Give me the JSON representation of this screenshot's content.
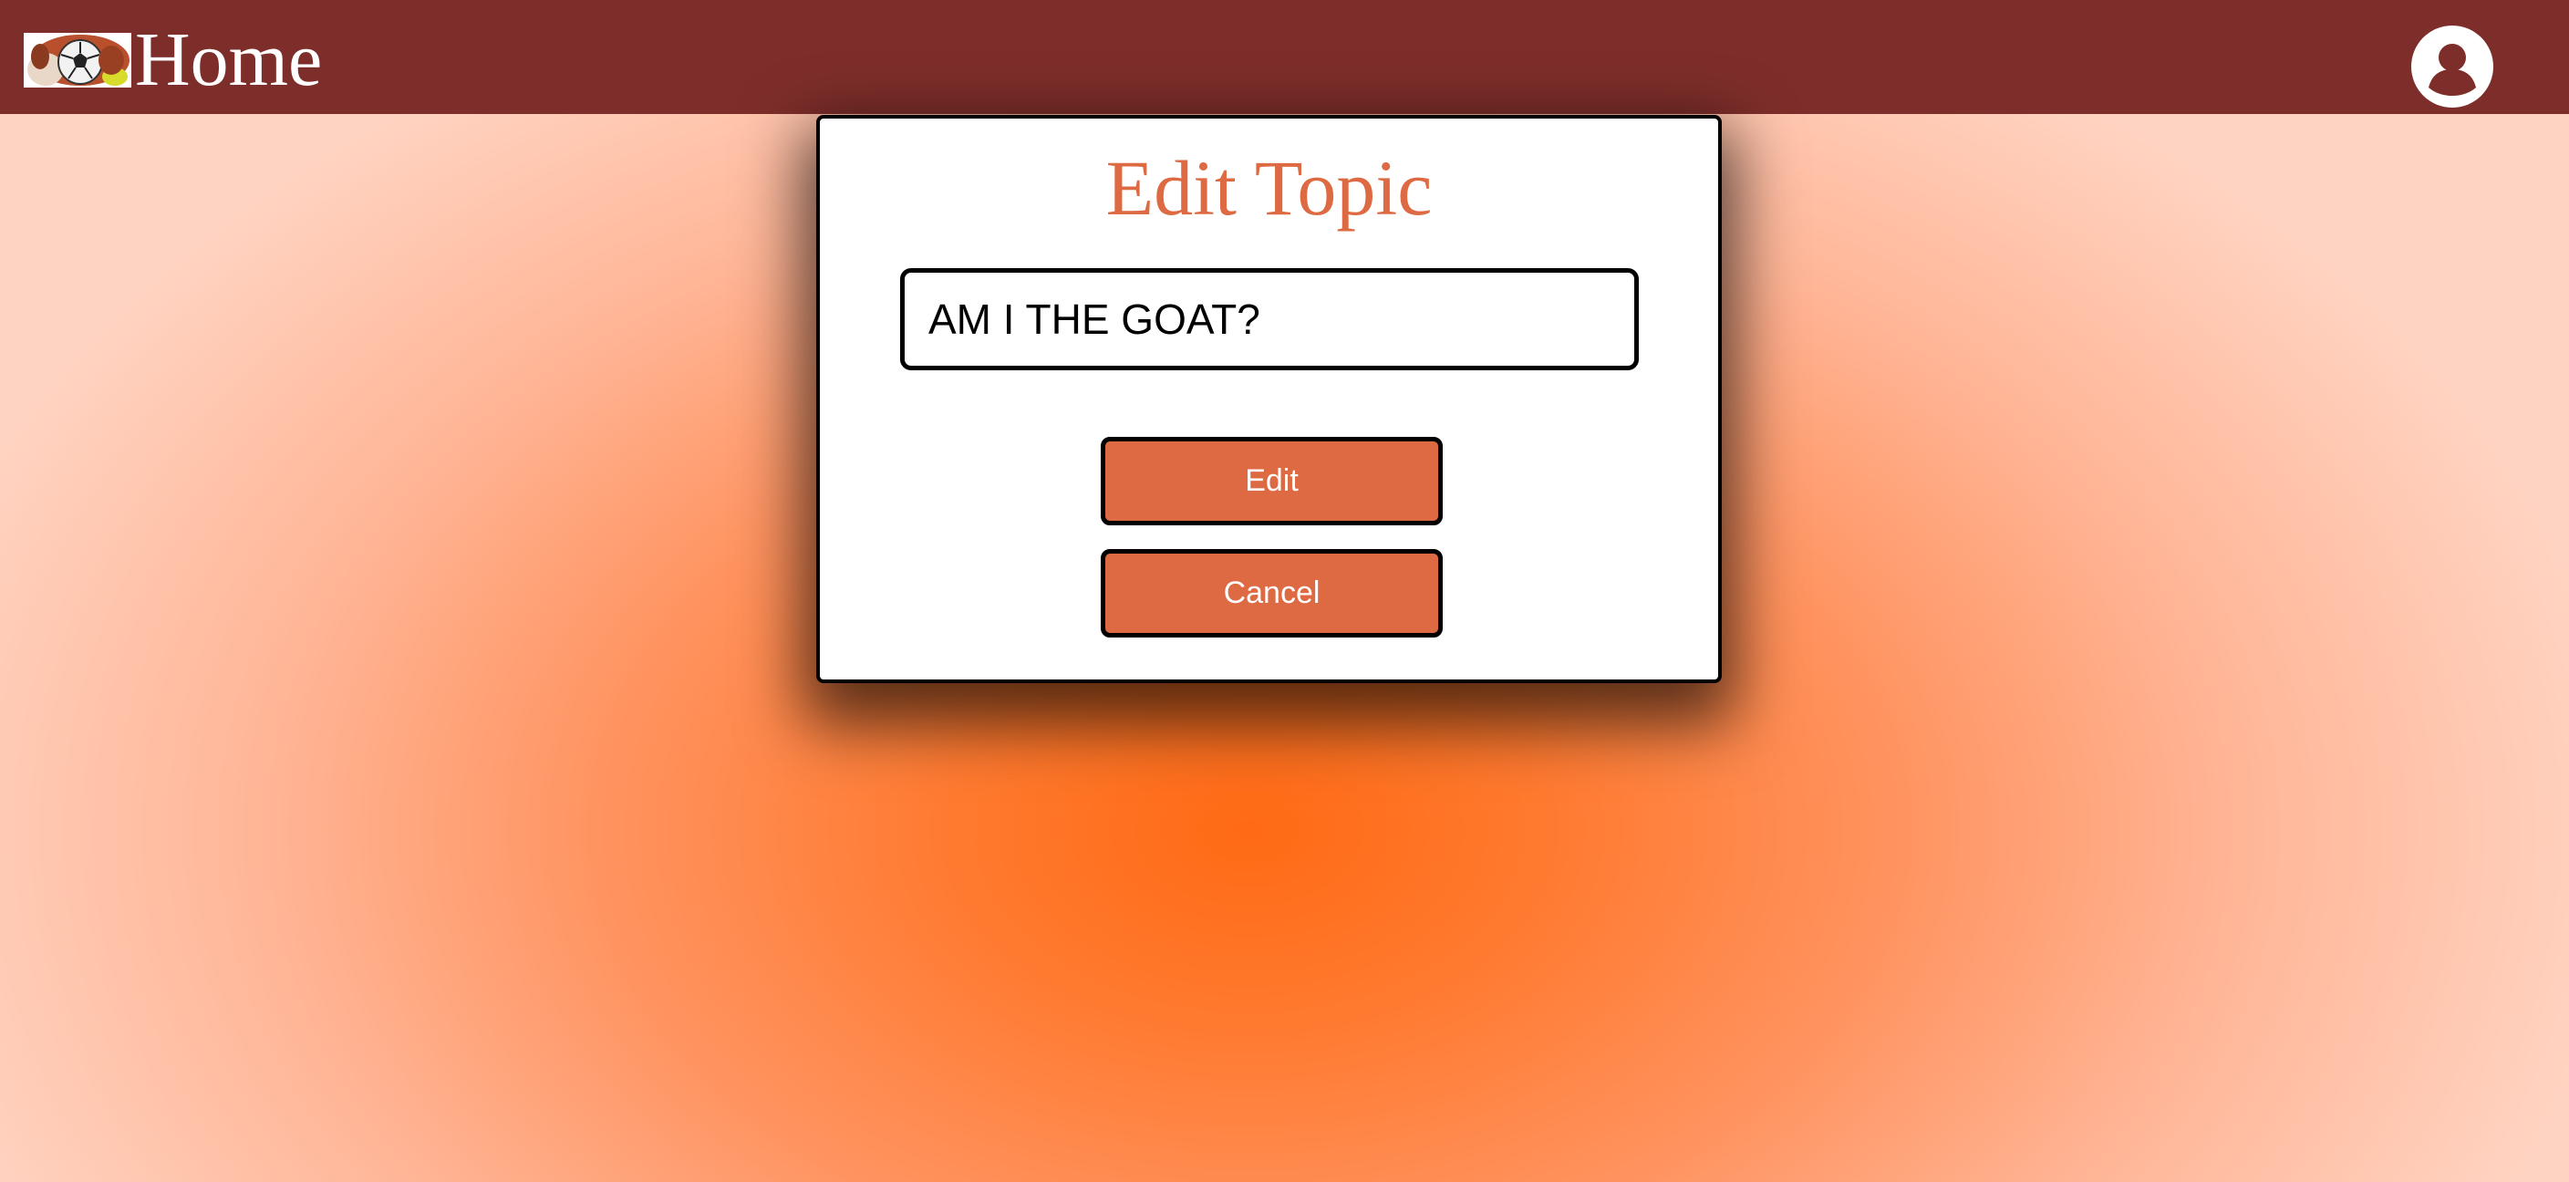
{
  "header": {
    "title": "Home",
    "logo_icon": "soccer-ball-dog-logo",
    "profile_icon": "user-profile-icon",
    "background_color": "#7e2e2a"
  },
  "modal": {
    "title": "Edit Topic",
    "input_value": "AM I THE GOAT?",
    "edit_label": "Edit",
    "cancel_label": "Cancel",
    "accent_color": "#dd6a42"
  },
  "page": {
    "background_accent": "#ff6a14"
  }
}
